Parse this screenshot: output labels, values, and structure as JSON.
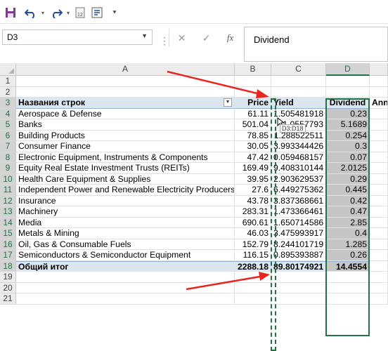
{
  "qat": {
    "save_icon": "save-icon",
    "undo_icon": "undo-icon",
    "redo_icon": "redo-icon",
    "calc_icon": "calculator-icon",
    "form_icon": "form-icon",
    "customize_icon": "customize-qat-icon"
  },
  "formula_bar": {
    "name_box": "D3",
    "cancel_icon": "✕",
    "enter_icon": "✓",
    "fx_label": "fx",
    "content": "Dividend"
  },
  "columns": [
    {
      "id": "A",
      "label": "A"
    },
    {
      "id": "B",
      "label": "B"
    },
    {
      "id": "C",
      "label": "C"
    },
    {
      "id": "D",
      "label": "D"
    }
  ],
  "rows": [
    "1",
    "2",
    "3",
    "4",
    "5",
    "6",
    "7",
    "8",
    "9",
    "10",
    "11",
    "12",
    "13",
    "14",
    "15",
    "16",
    "17",
    "18",
    "19",
    "20",
    "21"
  ],
  "table": {
    "headers": {
      "row_labels": "Названия строк",
      "price": "Price",
      "yield": "Yield",
      "dividend": "Dividend",
      "next_col": "Ann"
    },
    "data": [
      {
        "name": "Aerospace & Defense",
        "price": "61.11",
        "yield": "1.505481918",
        "dividend": "0.23"
      },
      {
        "name": "Banks",
        "price": "501.04",
        "yield": "1.0557793",
        "dividend": "5.1689"
      },
      {
        "name": "Building Products",
        "price": "78.85",
        "yield": "1.288522511",
        "dividend": "0.254"
      },
      {
        "name": "Consumer Finance",
        "price": "30.05",
        "yield": "3.993344426",
        "dividend": "0.3"
      },
      {
        "name": "Electronic Equipment, Instruments & Components",
        "price": "47.42",
        "yield": "0.059468157",
        "dividend": "0.07"
      },
      {
        "name": "Equity Real Estate Investment Trusts (REITs)",
        "price": "169.49",
        "yield": "9.408310144",
        "dividend": "2.0125"
      },
      {
        "name": "Health Care Equipment & Supplies",
        "price": "39.95",
        "yield": "2.903629537",
        "dividend": "0.29"
      },
      {
        "name": "Independent Power and Renewable Electricity Producers",
        "price": "27.6",
        "yield": "6.449275362",
        "dividend": "0.445"
      },
      {
        "name": "Insurance",
        "price": "43.78",
        "yield": "3.837368661",
        "dividend": "0.42"
      },
      {
        "name": "Machinery",
        "price": "283.31",
        "yield": "1.473366461",
        "dividend": "0.47"
      },
      {
        "name": "Media",
        "price": "690.61",
        "yield": "1.650714586",
        "dividend": "2.85"
      },
      {
        "name": "Metals & Mining",
        "price": "46.03",
        "yield": "3.475993917",
        "dividend": "0.4"
      },
      {
        "name": "Oil, Gas & Consumable Fuels",
        "price": "152.79",
        "yield": "8.244101719",
        "dividend": "1.285"
      },
      {
        "name": "Semiconductors & Semiconductor Equipment",
        "price": "116.15",
        "yield": "0.895393887",
        "dividend": "0.26"
      }
    ],
    "total": {
      "name": "Общий итог",
      "price": "2288.18",
      "yield": "89.80174921",
      "dividend": "14.4554"
    }
  },
  "selection_tooltip": "D3:D18",
  "colors": {
    "accent": "#217346",
    "pivot_header_bg": "#dce6f1",
    "arrow": "#e8251f",
    "selected_fill": "#c6c6c6"
  }
}
